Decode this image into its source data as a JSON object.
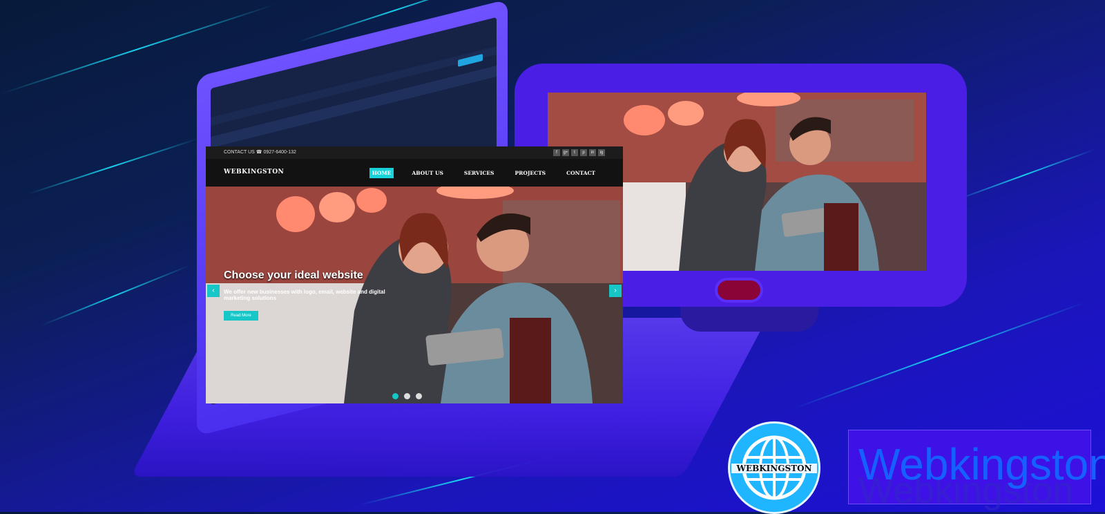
{
  "site": {
    "topbar": {
      "contact": "CONTACT US ☎ 0927-6400-132",
      "social_icons": [
        "f",
        "g+",
        "t",
        "p",
        "in",
        "ig"
      ]
    },
    "logo": "WEBKINGSTON",
    "nav": [
      {
        "label": "HOME",
        "active": true
      },
      {
        "label": "ABOUT US",
        "active": false
      },
      {
        "label": "SERVICES",
        "active": false
      },
      {
        "label": "PROJECTS",
        "active": false
      },
      {
        "label": "CONTACT",
        "active": false
      }
    ],
    "hero": {
      "title": "Choose your ideal website",
      "subtitle": "We offer new businesses with logo, email, website and digital marketing solutions",
      "button": "Read More",
      "slides_total": 3,
      "active_slide": 1
    }
  },
  "badge": {
    "text": "WEBKINGSTON"
  },
  "wordmark": {
    "text": "Webkingston"
  },
  "colors": {
    "accent": "#17d2d8",
    "device_purple": "#4a1ee4",
    "background": "#1a16b8",
    "wordmark": "#1560ff"
  }
}
